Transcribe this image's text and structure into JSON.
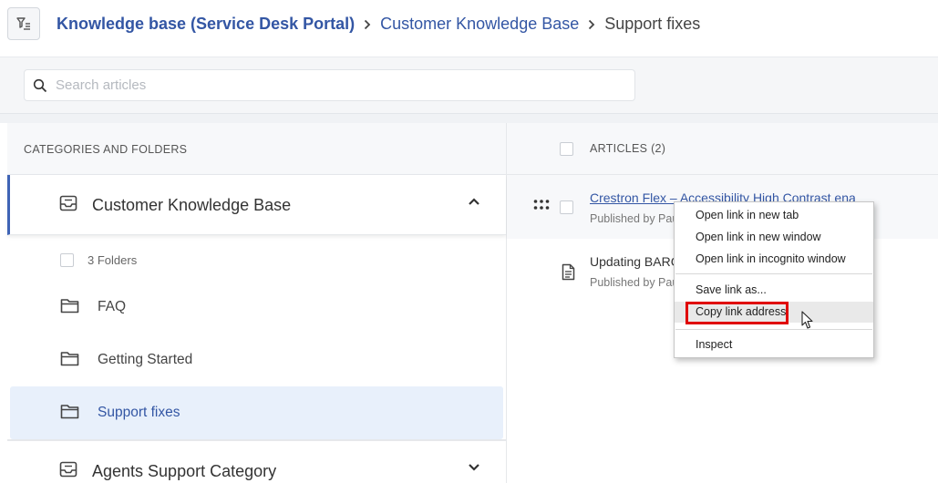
{
  "header": {
    "breadcrumb": [
      "Knowledge base (Service Desk Portal)",
      "Customer Knowledge Base",
      "Support fixes"
    ]
  },
  "search": {
    "placeholder": "Search articles"
  },
  "left_panel": {
    "header": "CATEGORIES AND FOLDERS",
    "categories": [
      {
        "label": "Customer Knowledge Base",
        "expanded": true,
        "folders_count_label": "3 Folders",
        "folders": [
          "FAQ",
          "Getting Started",
          "Support fixes"
        ],
        "selected_folder": "Support fixes"
      },
      {
        "label": "Agents Support Category",
        "expanded": false
      }
    ]
  },
  "right_panel": {
    "header": "ARTICLES (2)",
    "articles": [
      {
        "title": "Crestron Flex – Accessibility High Contrast ena",
        "meta": "Published by Pau"
      },
      {
        "title": "Updating BARC",
        "meta": "Published by Pau"
      }
    ]
  },
  "context_menu": {
    "items": [
      "Open link in new tab",
      "Open link in new window",
      "Open link in incognito window",
      "Save link as...",
      "Copy link address",
      "Inspect"
    ],
    "highlighted": "Copy link address"
  },
  "colors": {
    "accent": "#3356a4",
    "selected_bg": "#e8f0fb",
    "annotation_red": "#e00000"
  }
}
